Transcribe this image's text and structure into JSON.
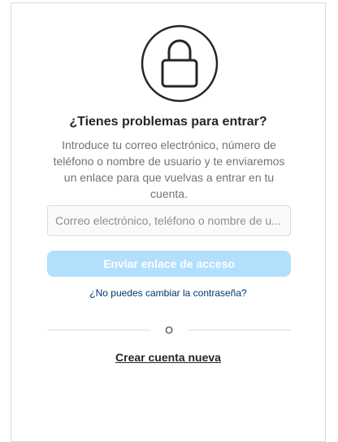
{
  "icon": "lock-icon",
  "title": "¿Tienes problemas para entrar?",
  "description": "Introduce tu correo electrónico, número de teléfono o nombre de usuario y te enviaremos un enlace para que vuelvas a entrar en tu cuenta.",
  "identifier_input": {
    "placeholder": "Correo electrónico, teléfono o nombre de u...",
    "value": ""
  },
  "submit_button": {
    "label": "Enviar enlace de acceso",
    "enabled": false
  },
  "cant_reset_link": "¿No puedes cambiar la contraseña?",
  "divider_text": "O",
  "create_account_link": "Crear cuenta nueva",
  "colors": {
    "button_disabled": "#b2dffc",
    "link": "#00376b",
    "text_primary": "#262626",
    "text_secondary": "#737373",
    "border": "#dbdbdb"
  }
}
